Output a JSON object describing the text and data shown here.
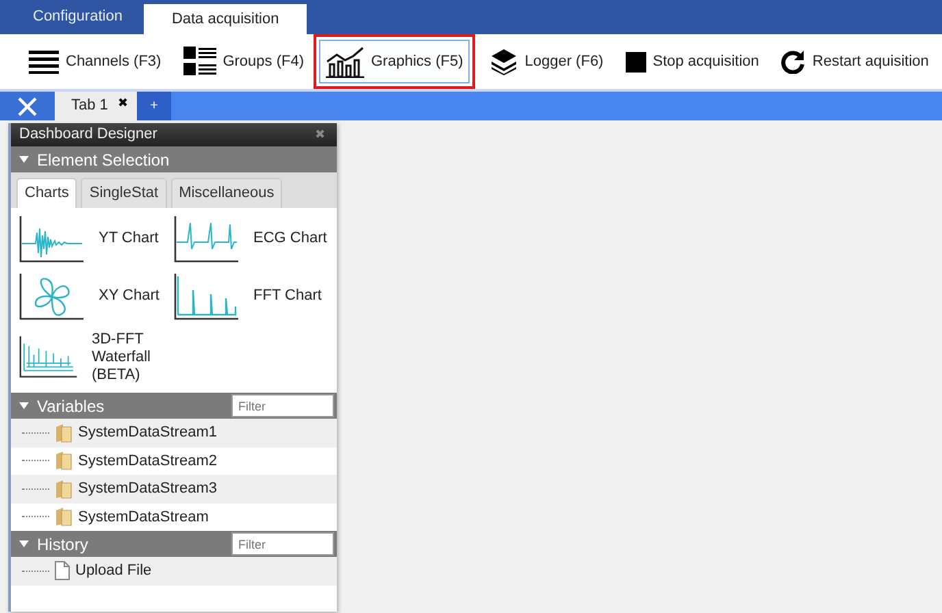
{
  "main_tabs": [
    {
      "label": "Configuration",
      "selected": false
    },
    {
      "label": "Data acquisition",
      "selected": true
    }
  ],
  "toolbar": [
    {
      "kind": "channels",
      "label": "Channels (F3)",
      "selected": false
    },
    {
      "kind": "groups",
      "label": "Groups (F4)",
      "selected": false
    },
    {
      "kind": "graphics",
      "label": "Graphics (F5)",
      "selected": true
    },
    {
      "kind": "logger",
      "label": "Logger (F6)",
      "selected": false
    },
    {
      "kind": "stop",
      "label": "Stop acquisition",
      "selected": false
    },
    {
      "kind": "restart",
      "label": "Restart aquisition",
      "selected": false
    }
  ],
  "dashboard_tabs": [
    {
      "label": "Tab 1",
      "close": "✖"
    }
  ],
  "add_tab": "+",
  "panel": {
    "title": "Dashboard Designer",
    "close": "✖",
    "element_selection": {
      "title": "Element Selection",
      "expanded": true,
      "tabs": [
        {
          "label": "Charts",
          "selected": true
        },
        {
          "label": "SingleStat",
          "selected": false
        },
        {
          "label": "Miscellaneous",
          "selected": false
        }
      ],
      "charts": [
        {
          "kind": "yt",
          "label": "YT Chart"
        },
        {
          "kind": "ecg",
          "label": "ECG Chart"
        },
        {
          "kind": "xy",
          "label": "XY Chart"
        },
        {
          "kind": "fft",
          "label": "FFT Chart"
        },
        {
          "kind": "waterfall",
          "label": "3D-FFT Waterfall (BETA)"
        }
      ]
    },
    "variables": {
      "title": "Variables",
      "expanded": true,
      "placeholder": "Filter",
      "items": [
        {
          "kind": "folder",
          "label": "SystemDataStream1"
        },
        {
          "kind": "folder",
          "label": "SystemDataStream2"
        },
        {
          "kind": "folder",
          "label": "SystemDataStream3"
        },
        {
          "kind": "folder",
          "label": "SystemDataStream"
        }
      ]
    },
    "history": {
      "title": "History",
      "expanded": true,
      "placeholder": "Filter",
      "items": [
        {
          "kind": "file",
          "label": "Upload File"
        }
      ]
    }
  }
}
